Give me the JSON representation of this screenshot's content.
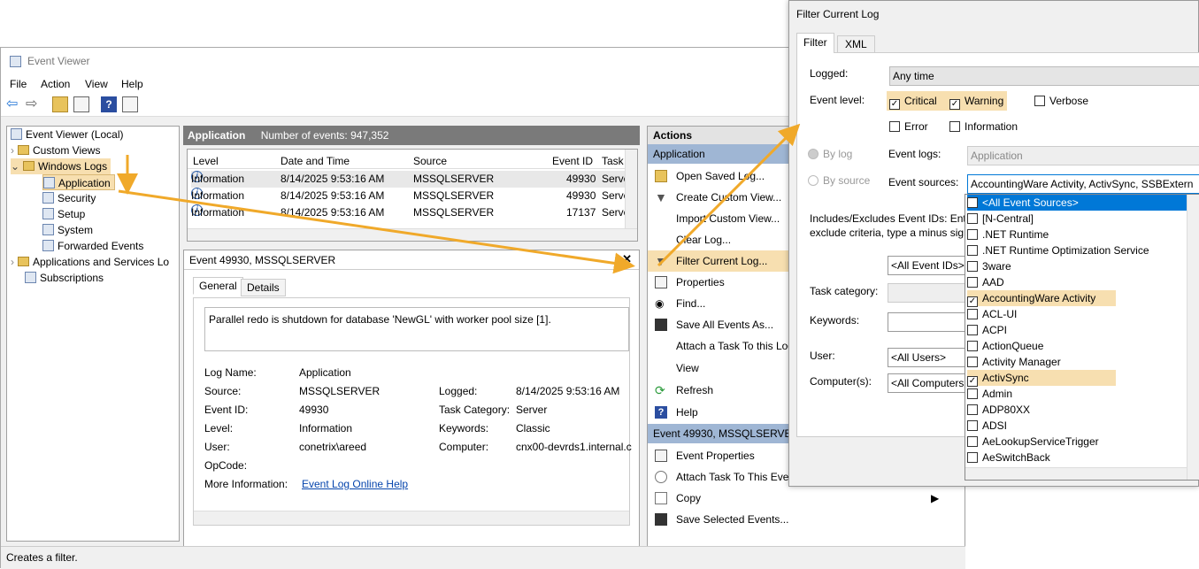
{
  "window": {
    "title": "Event Viewer",
    "menu": [
      "File",
      "Action",
      "View",
      "Help"
    ],
    "status": "Creates a filter."
  },
  "tree": {
    "root": "Event Viewer (Local)",
    "custom_views": "Custom Views",
    "windows_logs": "Windows Logs",
    "logs": [
      "Application",
      "Security",
      "Setup",
      "System",
      "Forwarded Events"
    ],
    "apps_services": "Applications and Services Lo",
    "subscriptions": "Subscriptions"
  },
  "list": {
    "title": "Application",
    "count": "Number of events: 947,352",
    "columns": [
      "Level",
      "Date and Time",
      "Source",
      "Event ID",
      "Task"
    ],
    "rows": [
      {
        "level": "Information",
        "date": "8/14/2025 9:53:16 AM",
        "source": "MSSQLSERVER",
        "id": "49930",
        "task": "Serve"
      },
      {
        "level": "Information",
        "date": "8/14/2025 9:53:16 AM",
        "source": "MSSQLSERVER",
        "id": "49930",
        "task": "Serve"
      },
      {
        "level": "Information",
        "date": "8/14/2025 9:53:16 AM",
        "source": "MSSQLSERVER",
        "id": "17137",
        "task": "Serve"
      }
    ]
  },
  "detail": {
    "title": "Event 49930, MSSQLSERVER",
    "tabs": [
      "General",
      "Details"
    ],
    "message": "Parallel redo is shutdown for database 'NewGL' with worker pool size [1].",
    "labels": {
      "log_name": "Log Name:",
      "source": "Source:",
      "event_id": "Event ID:",
      "level": "Level:",
      "user": "User:",
      "opcode": "OpCode:",
      "more_info": "More Information:",
      "logged": "Logged:",
      "task_category": "Task Category:",
      "keywords": "Keywords:",
      "computer": "Computer:"
    },
    "values": {
      "log_name": "Application",
      "source": "MSSQLSERVER",
      "event_id": "49930",
      "level": "Information",
      "user": "conetrix\\areed",
      "more_info": "Event Log Online Help",
      "logged": "8/14/2025 9:53:16 AM",
      "task_category": "Server",
      "keywords": "Classic",
      "computer": "cnx00-devrds1.internal.c"
    }
  },
  "actions": {
    "title": "Actions",
    "section1": "Application",
    "items1": [
      "Open Saved Log...",
      "Create Custom View...",
      "Import Custom View...",
      "Clear Log...",
      "Filter Current Log...",
      "Properties",
      "Find...",
      "Save All Events As...",
      "Attach a Task To this Log...",
      "View",
      "Refresh",
      "Help"
    ],
    "section2": "Event 49930, MSSQLSERVER",
    "items2": [
      "Event Properties",
      "Attach Task To This Event...",
      "Copy",
      "Save Selected Events..."
    ]
  },
  "dialog": {
    "title": "Filter Current Log",
    "tabs": [
      "Filter",
      "XML"
    ],
    "logged_label": "Logged:",
    "logged_value": "Any time",
    "event_level_label": "Event level:",
    "levels": {
      "critical": "Critical",
      "warning": "Warning",
      "verbose": "Verbose",
      "error": "Error",
      "information": "Information"
    },
    "by_log": "By log",
    "by_source": "By source",
    "event_logs_label": "Event logs:",
    "event_logs_value": "Application",
    "event_sources_label": "Event sources:",
    "event_sources_value": "AccountingWare Activity, ActivSync, SSBExtern",
    "includes_line1": "Includes/Excludes Event IDs: Ente",
    "includes_line2": "exclude criteria, type a minus sign",
    "event_ids_value": "<All Event IDs>",
    "task_category_label": "Task category:",
    "keywords_label": "Keywords:",
    "user_label": "User:",
    "user_value": "<All Users>",
    "computers_label": "Computer(s):",
    "computers_value": "<All Computers",
    "sources": [
      {
        "label": "<All Event Sources>",
        "checked": false,
        "selected": true
      },
      {
        "label": "[N-Central]",
        "checked": false
      },
      {
        "label": ".NET Runtime",
        "checked": false
      },
      {
        "label": ".NET Runtime Optimization Service",
        "checked": false
      },
      {
        "label": "3ware",
        "checked": false
      },
      {
        "label": "AAD",
        "checked": false
      },
      {
        "label": "AccountingWare Activity",
        "checked": true
      },
      {
        "label": "ACL-UI",
        "checked": false
      },
      {
        "label": "ACPI",
        "checked": false
      },
      {
        "label": "ActionQueue",
        "checked": false
      },
      {
        "label": "Activity Manager",
        "checked": false
      },
      {
        "label": "ActivSync",
        "checked": true
      },
      {
        "label": "Admin",
        "checked": false
      },
      {
        "label": "ADP80XX",
        "checked": false
      },
      {
        "label": "ADSI",
        "checked": false
      },
      {
        "label": "AeLookupServiceTrigger",
        "checked": false
      },
      {
        "label": "AeSwitchBack",
        "checked": false
      }
    ]
  },
  "colors": {
    "highlight": "#f7dfb0",
    "arrow": "#f0a92a",
    "selected": "#0078d7"
  }
}
